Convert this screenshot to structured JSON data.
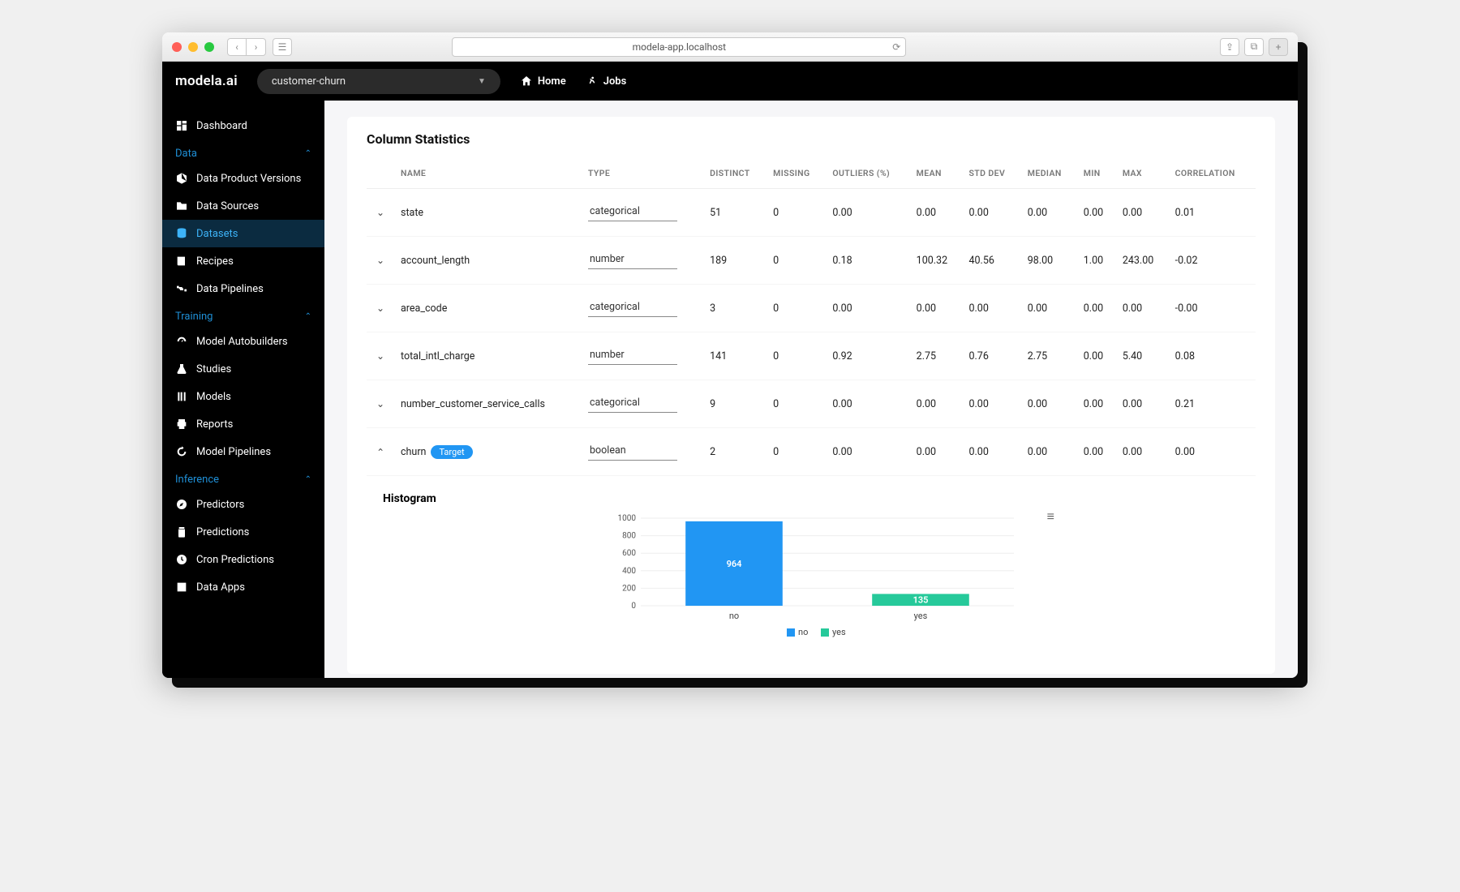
{
  "browser": {
    "url": "modela-app.localhost"
  },
  "app": {
    "brand": "modela.ai",
    "project": "customer-churn",
    "nav_home": "Home",
    "nav_jobs": "Jobs"
  },
  "sidebar": {
    "dashboard": "Dashboard",
    "groups": [
      {
        "label": "Data",
        "items": [
          {
            "label": "Data Product Versions",
            "icon": "cube-icon"
          },
          {
            "label": "Data Sources",
            "icon": "folder-icon"
          },
          {
            "label": "Datasets",
            "icon": "database-icon",
            "active": true
          },
          {
            "label": "Recipes",
            "icon": "book-icon"
          },
          {
            "label": "Data Pipelines",
            "icon": "pipeline-icon"
          }
        ]
      },
      {
        "label": "Training",
        "items": [
          {
            "label": "Model Autobuilders",
            "icon": "gauge-icon"
          },
          {
            "label": "Studies",
            "icon": "flask-icon"
          },
          {
            "label": "Models",
            "icon": "model-icon"
          },
          {
            "label": "Reports",
            "icon": "printer-icon"
          },
          {
            "label": "Model Pipelines",
            "icon": "cycle-icon"
          }
        ]
      },
      {
        "label": "Inference",
        "items": [
          {
            "label": "Predictors",
            "icon": "compass-icon"
          },
          {
            "label": "Predictions",
            "icon": "jar-icon"
          },
          {
            "label": "Cron Predictions",
            "icon": "clock-icon"
          },
          {
            "label": "Data Apps",
            "icon": "chart-icon"
          }
        ]
      }
    ]
  },
  "main": {
    "title": "Column Statistics",
    "columns": [
      "NAME",
      "TYPE",
      "DISTINCT",
      "MISSING",
      "OUTLIERS (%)",
      "MEAN",
      "STD DEV",
      "MEDIAN",
      "MIN",
      "MAX",
      "CORRELATION"
    ],
    "rows": [
      {
        "expand": false,
        "name": "state",
        "type": "categorical",
        "distinct": "51",
        "missing": "0",
        "outliers": "0.00",
        "mean": "0.00",
        "stddev": "0.00",
        "median": "0.00",
        "min": "0.00",
        "max": "0.00",
        "corr": "0.01"
      },
      {
        "expand": false,
        "name": "account_length",
        "type": "number",
        "distinct": "189",
        "missing": "0",
        "outliers": "0.18",
        "mean": "100.32",
        "stddev": "40.56",
        "median": "98.00",
        "min": "1.00",
        "max": "243.00",
        "corr": "-0.02"
      },
      {
        "expand": false,
        "name": "area_code",
        "type": "categorical",
        "distinct": "3",
        "missing": "0",
        "outliers": "0.00",
        "mean": "0.00",
        "stddev": "0.00",
        "median": "0.00",
        "min": "0.00",
        "max": "0.00",
        "corr": "-0.00"
      },
      {
        "expand": false,
        "name": "total_intl_charge",
        "type": "number",
        "distinct": "141",
        "missing": "0",
        "outliers": "0.92",
        "mean": "2.75",
        "stddev": "0.76",
        "median": "2.75",
        "min": "0.00",
        "max": "5.40",
        "corr": "0.08"
      },
      {
        "expand": false,
        "name": "number_customer_service_calls",
        "type": "categorical",
        "distinct": "9",
        "missing": "0",
        "outliers": "0.00",
        "mean": "0.00",
        "stddev": "0.00",
        "median": "0.00",
        "min": "0.00",
        "max": "0.00",
        "corr": "0.21"
      },
      {
        "expand": true,
        "name": "churn",
        "target": "Target",
        "type": "boolean",
        "distinct": "2",
        "missing": "0",
        "outliers": "0.00",
        "mean": "0.00",
        "stddev": "0.00",
        "median": "0.00",
        "min": "0.00",
        "max": "0.00",
        "corr": "0.00"
      }
    ],
    "histogram_title": "Histogram"
  },
  "chart_data": {
    "type": "bar",
    "categories": [
      "no",
      "yes"
    ],
    "values": [
      964,
      135
    ],
    "ylim": [
      0,
      1000
    ],
    "yticks": [
      0,
      200,
      400,
      600,
      800,
      1000
    ],
    "legend": [
      "no",
      "yes"
    ],
    "colors": {
      "no": "#2196f3",
      "yes": "#26c99a"
    }
  }
}
